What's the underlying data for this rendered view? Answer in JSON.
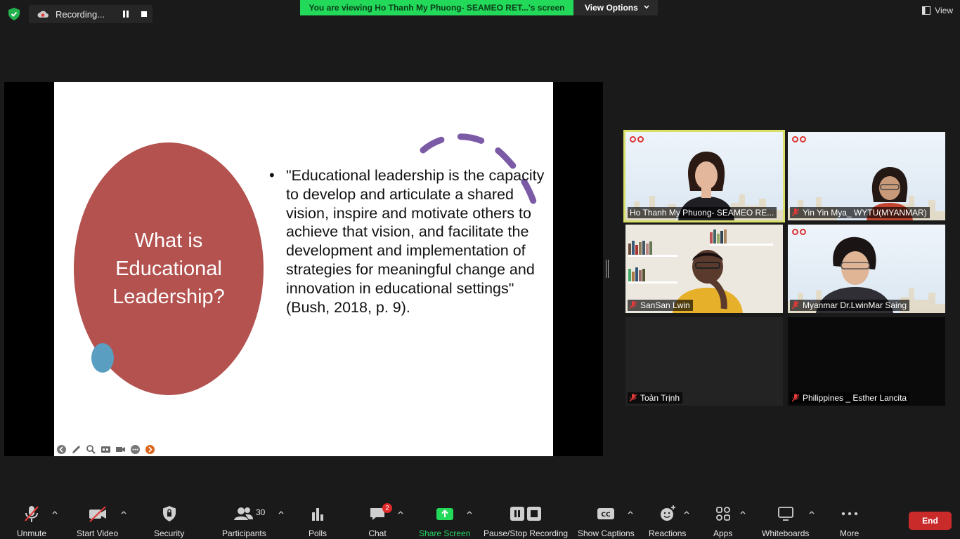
{
  "top_bar": {
    "recording_label": "Recording...",
    "viewing_banner": "You are viewing Ho Thanh My Phuong- SEAMEO RET...'s screen",
    "view_options_label": "View Options",
    "view_label": "View"
  },
  "slide": {
    "circle_title": "What is Educational Leadership?",
    "bullet": "•",
    "quote": "\"Educational leadership is the capacity to develop and articulate a shared vision, inspire and motivate others to achieve that vision, and facilitate the development and implementation of strategies for meaningful change and innovation in educational settings\" (Bush, 2018, p. 9).",
    "colors": {
      "circle": "#b3524f",
      "dot": "#5a9fc2",
      "arc": "#7b5aa6"
    }
  },
  "participants_tiles": [
    {
      "name": "Ho Thanh My Phuong- SEAMEO RE...",
      "active_speaker": true,
      "muted": false
    },
    {
      "name": "Yin Yin Mya_ WYTU(MYANMAR)",
      "active_speaker": false,
      "muted": true
    },
    {
      "name": "SanSan Lwin",
      "active_speaker": false,
      "muted": true
    },
    {
      "name": "Myanmar Dr.LwinMar Saing",
      "active_speaker": false,
      "muted": true
    },
    {
      "name": "Toản Trịnh",
      "active_speaker": false,
      "muted": true
    },
    {
      "name": "Philippines _ Esther Lancita",
      "active_speaker": false,
      "muted": true
    }
  ],
  "toolbar": {
    "unmute": "Unmute",
    "start_video": "Start Video",
    "security": "Security",
    "participants": "Participants",
    "participants_count": "30",
    "polls": "Polls",
    "chat": "Chat",
    "chat_badge": "2",
    "share_screen": "Share Screen",
    "pause_stop_recording": "Pause/Stop Recording",
    "show_captions": "Show Captions",
    "reactions": "Reactions",
    "apps": "Apps",
    "whiteboards": "Whiteboards",
    "more": "More",
    "end": "End",
    "accent_share": "#23d959",
    "accent_end": "#c92b2b"
  }
}
